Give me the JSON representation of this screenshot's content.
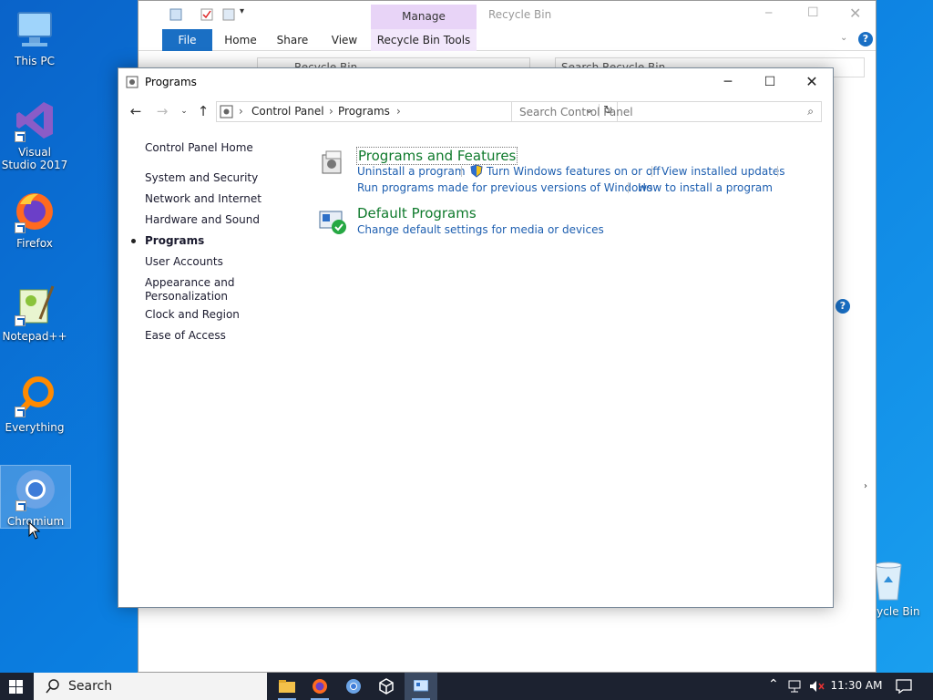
{
  "desktop": {
    "icons": [
      {
        "label": "This PC",
        "icon": "this-pc-icon"
      },
      {
        "label": "Visual Studio 2017",
        "icon": "visual-studio-icon"
      },
      {
        "label": "Firefox",
        "icon": "firefox-icon"
      },
      {
        "label": "Notepad++",
        "icon": "notepadpp-icon"
      },
      {
        "label": "Everything",
        "icon": "everything-icon"
      },
      {
        "label": "Chromium",
        "icon": "chromium-icon"
      },
      {
        "label": "Recycle Bin",
        "icon": "recycle-bin-icon"
      }
    ]
  },
  "explorer": {
    "title": "Recycle Bin",
    "manage_label": "Manage",
    "tabs": [
      "File",
      "Home",
      "Share",
      "View",
      "Recycle Bin Tools"
    ],
    "address": "Recycle Bin",
    "search_placeholder": "Search Recycle Bin"
  },
  "control_panel": {
    "title": "Programs",
    "breadcrumb": [
      "Control Panel",
      "Programs"
    ],
    "search_placeholder": "Search Control Panel",
    "nav": [
      {
        "label": "Control Panel Home",
        "current": false
      },
      {
        "label": "System and Security",
        "current": false
      },
      {
        "label": "Network and Internet",
        "current": false
      },
      {
        "label": "Hardware and Sound",
        "current": false
      },
      {
        "label": "Programs",
        "current": true
      },
      {
        "label": "User Accounts",
        "current": false
      },
      {
        "label": "Appearance and",
        "label2": "Personalization",
        "current": false
      },
      {
        "label": "Clock and Region",
        "current": false
      },
      {
        "label": "Ease of Access",
        "current": false
      }
    ],
    "sections": [
      {
        "title": "Programs and Features",
        "links": [
          "Uninstall a program",
          "Turn Windows features on or off",
          "View installed updates",
          "Run programs made for previous versions of Windows",
          "How to install a program"
        ]
      },
      {
        "title": "Default Programs",
        "links": [
          "Change default settings for media or devices"
        ]
      }
    ]
  },
  "taskbar": {
    "search_label": "Search",
    "clock": "11:30 AM",
    "apps": [
      "file-explorer-icon",
      "firefox-icon",
      "chromium-icon",
      "virtualbox-icon",
      "control-panel-icon"
    ]
  },
  "colors": {
    "section_title": "#0f7a2c",
    "link": "#1e5fb0",
    "taskbar": "#1c2230",
    "ribbon_file": "#1a6fc4"
  }
}
